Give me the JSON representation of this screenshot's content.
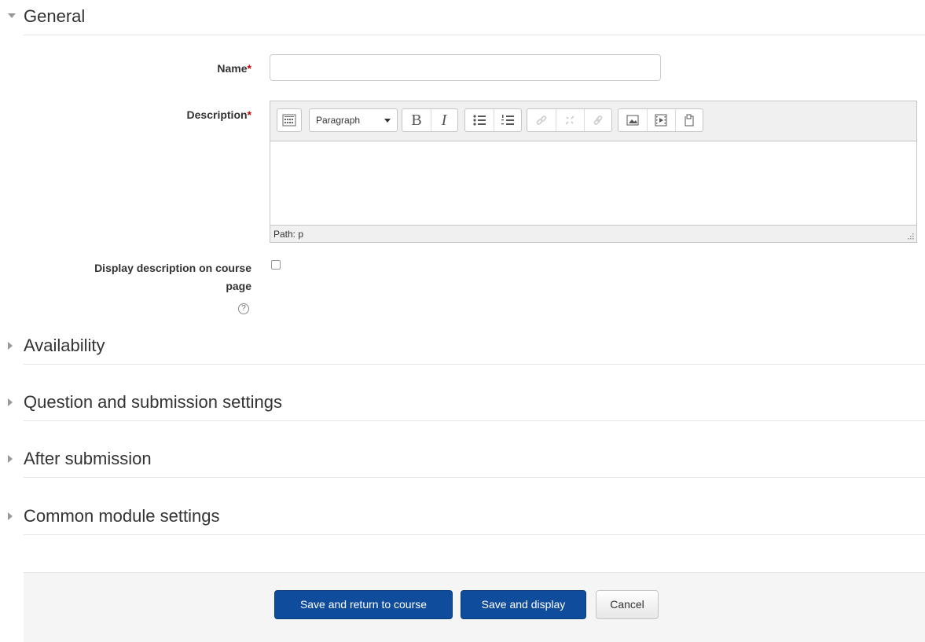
{
  "sections": {
    "general": "General",
    "availability": "Availability",
    "question_submission": "Question and submission settings",
    "after_submission": "After submission",
    "common_module": "Common module settings"
  },
  "fields": {
    "name_label": "Name",
    "name_value": "",
    "description_label": "Description",
    "required_marker": "*",
    "display_desc_label_line1": "Display description on course",
    "display_desc_label_line2": "page",
    "display_desc_checked": false,
    "help_glyph": "?"
  },
  "editor": {
    "format_select": "Paragraph",
    "bold": "B",
    "italic": "I",
    "path": "Path: p",
    "content": ""
  },
  "buttons": {
    "save_return": "Save and return to course",
    "save_display": "Save and display",
    "cancel": "Cancel"
  },
  "icons": {
    "toolbar_toggle": "toolbar-toggle-icon",
    "unordered_list": "unordered-list-icon",
    "ordered_list": "ordered-list-icon",
    "link": "link-icon",
    "unlink": "unlink-icon",
    "anchor": "anchor-icon",
    "image": "image-icon",
    "media": "media-icon",
    "manage_files": "manage-files-icon"
  },
  "colors": {
    "primary_button": "#0f4c9c",
    "required": "#cc0000"
  }
}
